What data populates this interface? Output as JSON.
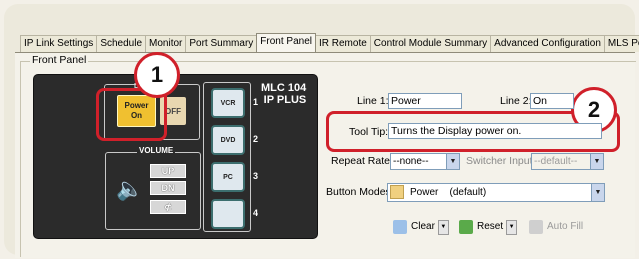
{
  "tabs": [
    {
      "label": "IP Link Settings",
      "active": false
    },
    {
      "label": "Schedule",
      "active": false
    },
    {
      "label": "Monitor",
      "active": false
    },
    {
      "label": "Port Summary",
      "active": false
    },
    {
      "label": "Front Panel",
      "active": true
    },
    {
      "label": "IR Remote",
      "active": false
    },
    {
      "label": "Control Module Summary",
      "active": false
    },
    {
      "label": "Advanced Configuration",
      "active": false
    },
    {
      "label": "MLS Port",
      "active": false
    }
  ],
  "group_label": "Front Panel",
  "device": {
    "model_line1": "MLC 104",
    "model_line2": "IP PLUS",
    "display_label": "D",
    "power_button": {
      "line1": "Power",
      "line2": "On"
    },
    "off_button": "OFF",
    "volume_label": "VOLUME",
    "volume_up": "UP",
    "volume_down": "DN",
    "mute_symbol": "⊄",
    "sources": [
      {
        "label": "VCR",
        "number": "1"
      },
      {
        "label": "DVD",
        "number": "2"
      },
      {
        "label": "PC",
        "number": "3"
      },
      {
        "label": "",
        "number": "4"
      }
    ]
  },
  "callouts": {
    "one": "1",
    "two": "2"
  },
  "form": {
    "line1_label": "Line 1:",
    "line1_value": "Power",
    "line2_label": "Line 2:",
    "line2_value": "On",
    "tooltip_label": "Tool Tip:",
    "tooltip_value": "Turns the Display power on.",
    "repeat_rate_label": "Repeat Rate:",
    "repeat_rate_value": "--none--",
    "switcher_input_label": "Switcher Input:",
    "switcher_input_value": "--default--",
    "button_modes_label": "Button Modes:",
    "button_modes_value": "Power",
    "button_modes_suffix": "(default)"
  },
  "toolbar": {
    "clear": "Clear",
    "reset": "Reset",
    "autofill": "Auto Fill"
  },
  "colors": {
    "callout_red": "#d0202a",
    "power_yellow": "#f0c030"
  }
}
